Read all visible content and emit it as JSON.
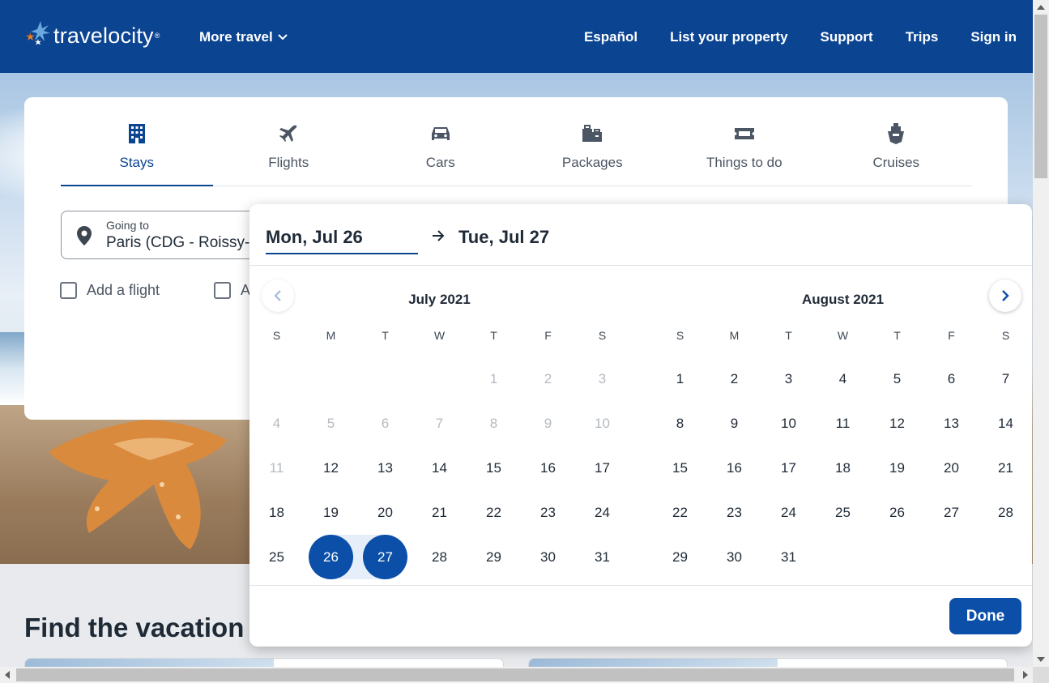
{
  "header": {
    "brand": "travelocity",
    "more_travel": "More travel",
    "nav": [
      "Español",
      "List your property",
      "Support",
      "Trips",
      "Sign in"
    ]
  },
  "tabs": [
    {
      "label": "Stays",
      "icon": "hotel-icon",
      "active": true
    },
    {
      "label": "Flights",
      "icon": "plane-icon",
      "active": false
    },
    {
      "label": "Cars",
      "icon": "car-icon",
      "active": false
    },
    {
      "label": "Packages",
      "icon": "packages-icon",
      "active": false
    },
    {
      "label": "Things to do",
      "icon": "ticket-icon",
      "active": false
    },
    {
      "label": "Cruises",
      "icon": "cruise-icon",
      "active": false
    }
  ],
  "search": {
    "going_to_label": "Going to",
    "going_to_value": "Paris (CDG - Roissy-C",
    "add_flight": "Add a flight",
    "add_car_partial": "A"
  },
  "picker": {
    "start_date": "Mon, Jul 26",
    "end_date": "Tue, Jul 27",
    "weekdays": [
      "S",
      "M",
      "T",
      "W",
      "T",
      "F",
      "S"
    ],
    "months": [
      {
        "title": "July 2021",
        "first_weekday": 4,
        "days": 31,
        "disabled_through": 11
      },
      {
        "title": "August 2021",
        "first_weekday": 0,
        "days": 31,
        "disabled_through": 0
      }
    ],
    "selected": [
      "26",
      "27"
    ],
    "done": "Done"
  },
  "page": {
    "section_title": "Find the vacation"
  },
  "colors": {
    "brand_blue": "#0b4491",
    "selected_blue": "#0b4fa8",
    "logo_orange": "#f07d22",
    "logo_light_blue": "#6aa9de"
  }
}
